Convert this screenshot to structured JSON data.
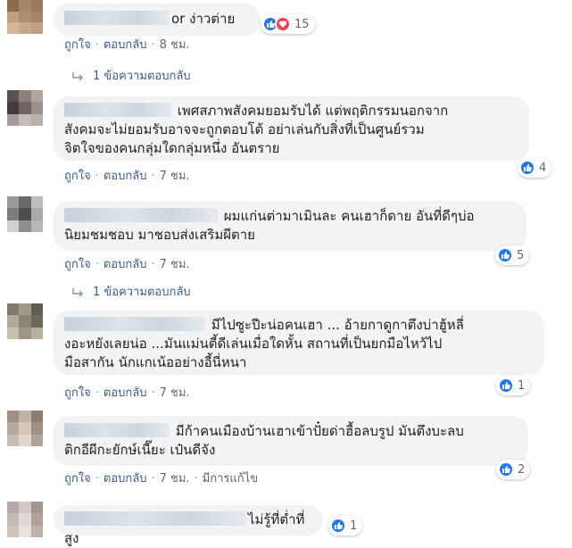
{
  "actions": {
    "like": "ถูกใจ",
    "reply": "ตอบกลับ",
    "edited": "มีการแก้ไข"
  },
  "comments": [
    {
      "name_visible": "or",
      "text": "ง่าวต่าย",
      "reactions": 15,
      "time": "8 ชม.",
      "replies": "1 ข้อความตอบกลับ"
    },
    {
      "text_lines": [
        "เพศสภาพสังคมยอมรับได้ แต่พฤติกรรมนอกจาก",
        "สังคมจะไม่ยอมรับอาจจะถูกตอบโต้ อย่าเล่นกับสิ่งที่เป็นศูนย์รวม",
        "จิตใจของคนกลุ่มใดกลุ่มหนึ่ง อันตราย"
      ],
      "reactions": 4,
      "time": "7 ชม."
    },
    {
      "text_lines": [
        "ผมแก่นต่ามาเมินละ คนเฮาก็ดาย อันที่ดีๆบ่อ",
        "นิยมชมชอบ มาชอบส่งเสริมผีตาย"
      ],
      "reactions": 5,
      "time": "7 ชม.",
      "replies": "1 ข้อความตอบกลับ"
    },
    {
      "text_lines": [
        "มีไปซูะปีะน่อคนเฮา ... อ้ายกาดูกาตึงบ่าฮู้หลี่",
        "งอะหยังเลยน่อ ...มันแม่นตี้ดีเล่นเมื่อใดหั้น สถานที่เป็นยกมือไหว้ไป",
        "มือสากัน นักแกเน้ออย่างอี้นี่หนา"
      ],
      "reactions": 1,
      "time": "7 ชม."
    },
    {
      "text_lines": [
        "มีก้าคนเมืองบ้านเฮาเข้าปั๋ยด่าฮื้อลบรูป มันตึงบะลบ",
        "ติกอีผีกะยักษ์เนี๊ยะ เป๋นดีจัง"
      ],
      "reactions": 2,
      "time": "7 ชม."
    },
    {
      "text": "ไม่รู้ที่ต่ำที่สูง",
      "reactions": 1
    }
  ],
  "colors": {
    "bubble": "#f2f3f5",
    "link": "#385898",
    "meta": "#606770",
    "like": "#2078f4",
    "love": "#f33e58"
  }
}
